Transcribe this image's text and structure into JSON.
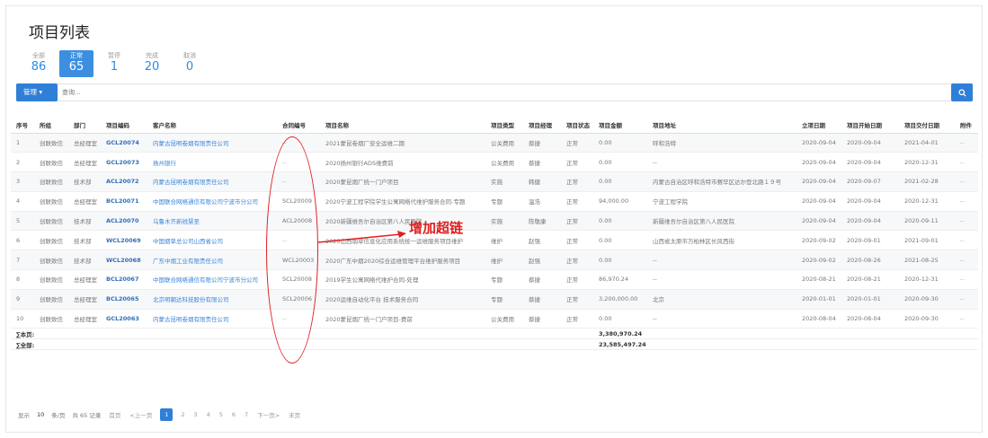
{
  "header": {
    "title": "项目列表"
  },
  "status_tabs": [
    {
      "label": "全部",
      "count": "86",
      "active": false
    },
    {
      "label": "正常",
      "count": "65",
      "active": true
    },
    {
      "label": "暂停",
      "count": "1",
      "active": false
    },
    {
      "label": "完成",
      "count": "20",
      "active": false
    },
    {
      "label": "取消",
      "count": "0",
      "active": false
    }
  ],
  "toolbar": {
    "manage_label": "管理 ▾",
    "search_placeholder": "查询..."
  },
  "table": {
    "columns": [
      "序号",
      "所组",
      "部门",
      "项目编码",
      "客户名称",
      "合同编号",
      "项目名称",
      "项目类型",
      "项目经理",
      "项目状态",
      "项目金额",
      "项目地址",
      "立项日期",
      "项目开始日期",
      "项目交付日期",
      "附件"
    ],
    "rows": [
      [
        "1",
        "创联致信",
        "总经理室",
        "GCL20074",
        "内蒙古昆明卷烟有限责任公司",
        "--",
        "2021蒙昆卷烟厂安全运维二期",
        "公关费用",
        "蔡捷",
        "正常",
        "0.00",
        "呼和浩特",
        "2020-09-04",
        "2020-09-04",
        "2021-04-01",
        "--"
      ],
      [
        "2",
        "创联致信",
        "总经理室",
        "GCL20073",
        "扬州银行",
        "--",
        "2020扬州银行ADS维费前",
        "公关费用",
        "蔡捷",
        "正常",
        "0.00",
        "--",
        "2020-09-04",
        "2020-09-04",
        "2020-12-31",
        "--"
      ],
      [
        "3",
        "创联致信",
        "技术部",
        "ACL20072",
        "内蒙古昆明卷烟有限责任公司",
        "--",
        "2020蒙昆烟厂统一门户项目",
        "实施",
        "韩健",
        "正常",
        "0.00",
        "内蒙古自治区呼和浩特市赛罕区达尔登北路１９号",
        "2020-09-04",
        "2020-09-07",
        "2021-02-28",
        "--"
      ],
      [
        "4",
        "创联致信",
        "总经理室",
        "BCL20071",
        "中国联合网络通信有限公司宁波市分公司",
        "SCL20009",
        "2020宁波工程学院学生公寓网络代维护服务合同-专题",
        "专题",
        "温浩",
        "正常",
        "94,000.00",
        "宁波工程学院",
        "2020-09-04",
        "2020-09-04",
        "2020-12-31",
        "--"
      ],
      [
        "5",
        "创联致信",
        "技术部",
        "ACL20070",
        "乌鲁木齐新锐慧至",
        "ACL20008",
        "2020新疆维吾尔自治区第八人民医院",
        "实施",
        "陈敬康",
        "正常",
        "0.00",
        "新疆维吾尔自治区第八人民医院",
        "2020-09-04",
        "2020-09-04",
        "2020-09-11",
        "--"
      ],
      [
        "6",
        "创联致信",
        "技术部",
        "WCL20069",
        "中国烟草总公司山西省公司",
        "--",
        "2020山西烟草信息化应用系统统一运维服务项目维护",
        "维护",
        "赵强",
        "正常",
        "0.00",
        "山西省太原市万柏林区长风西街",
        "2020-09-02",
        "2020-09-01",
        "2021-09-01",
        "--"
      ],
      [
        "7",
        "创联致信",
        "技术部",
        "WCL20068",
        "广东中烟工业有限责任公司",
        "WCL20003",
        "2020广东中烟2020综合运维管理平台维护服务项目",
        "维护",
        "赵强",
        "正常",
        "0.00",
        "--",
        "2020-09-02",
        "2020-08-26",
        "2021-08-25",
        "--"
      ],
      [
        "8",
        "创联致信",
        "总经理室",
        "BCL20067",
        "中国联合网络通信有限公司宁波市分公司",
        "SCL20008",
        "2019学生公寓网络代维护合同-处理",
        "专题",
        "蔡捷",
        "正常",
        "86,970.24",
        "--",
        "2020-08-21",
        "2020-08-21",
        "2020-12-31",
        "--"
      ],
      [
        "9",
        "创联致信",
        "总经理室",
        "BCL20065",
        "北京明朝达科技股份有限公司",
        "SCL20006",
        "2020运维自动化平台 技术服务合同",
        "专题",
        "蔡捷",
        "正常",
        "3,200,000.00",
        "北京",
        "2020-01-01",
        "2020-01-01",
        "2020-09-30",
        "--"
      ],
      [
        "10",
        "创联致信",
        "总经理室",
        "GCL20063",
        "内蒙古昆明卷烟有限责任公司",
        "--",
        "2020蒙昆烟厂统一门户项目-费前",
        "公关费用",
        "蔡捷",
        "正常",
        "0.00",
        "--",
        "2020-08-04",
        "2020-08-04",
        "2020-09-30",
        "--"
      ]
    ],
    "summary": {
      "page_label": "∑本页:",
      "page_total": "3,380,970.24",
      "all_label": "∑全部:",
      "all_total": "23,585,497.24"
    }
  },
  "pagination": {
    "show_label": "显示",
    "page_size": "10",
    "per_page_label": "条/页",
    "total_label": "共 65 记录",
    "first_label": "首页",
    "prev_label": "<上一页",
    "pages": [
      "1",
      "2",
      "3",
      "4",
      "5",
      "6",
      "7"
    ],
    "current_page": "1",
    "next_label": "下一页>",
    "last_label": "末页"
  },
  "annotation": {
    "text": "增加超链",
    "color": "#e02020"
  },
  "colors": {
    "accent": "#2f7fd8",
    "link": "#3a86d8",
    "annotation": "#e02020"
  },
  "icons": {
    "search": "search-icon",
    "dropdown": "caret-down-icon"
  }
}
